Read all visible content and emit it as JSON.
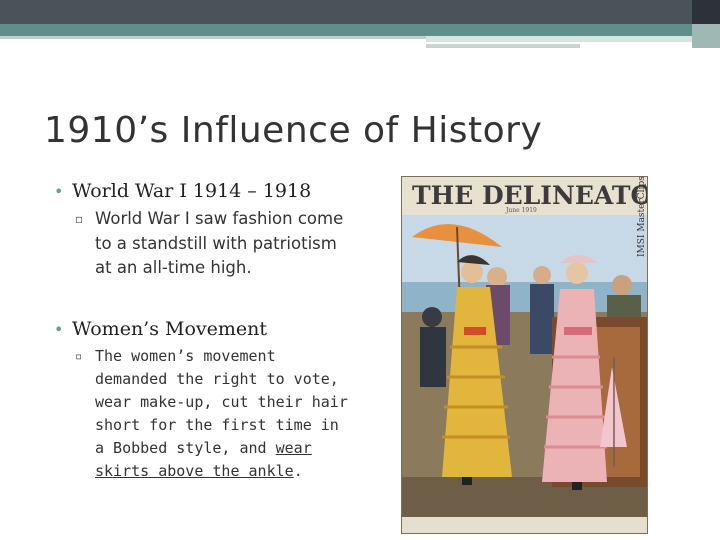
{
  "slide": {
    "title": "1910’s Influence of History",
    "bullets": [
      {
        "text": "World War I 1914 – 1918",
        "sub": "World War I saw fashion come to a standstill with patriotism at an all-time high."
      },
      {
        "text": "Women’s Movement",
        "sub_lead": "The women’s movement demanded the right to vote, wear make-up, cut their hair short for the first time in a Bobbed style, and ",
        "sub_underlined": "wear skirts above the ankle",
        "sub_end": "."
      }
    ]
  },
  "image": {
    "masthead": "THE DELINEATOR",
    "date": "June 1919",
    "watermark": "IMSI MasterClips"
  },
  "colors": {
    "topbar": "#4a525a",
    "accent_teal": "#5f8f88",
    "bullet": "#6b9a93"
  }
}
